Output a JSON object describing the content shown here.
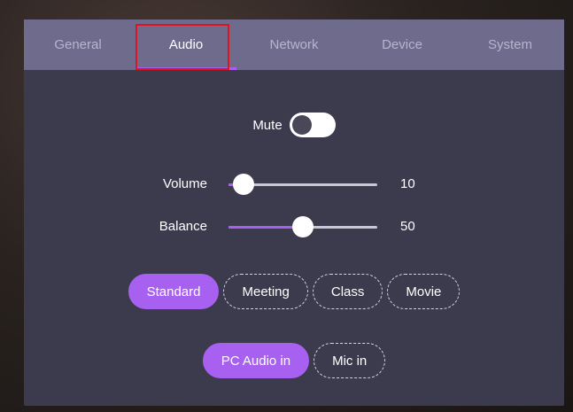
{
  "tabs": [
    {
      "label": "General"
    },
    {
      "label": "Audio"
    },
    {
      "label": "Network"
    },
    {
      "label": "Device"
    },
    {
      "label": "System"
    }
  ],
  "active_tab": "Audio",
  "mute": {
    "label": "Mute",
    "on": false
  },
  "volume": {
    "label": "Volume",
    "value": "10",
    "fraction": 0.1
  },
  "balance": {
    "label": "Balance",
    "value": "50",
    "fraction": 0.5
  },
  "sound_modes": [
    {
      "label": "Standard",
      "active": true
    },
    {
      "label": "Meeting",
      "active": false
    },
    {
      "label": "Class",
      "active": false
    },
    {
      "label": "Movie",
      "active": false
    }
  ],
  "audio_inputs": [
    {
      "label": "PC Audio in",
      "active": true
    },
    {
      "label": "Mic in",
      "active": false
    }
  ],
  "colors": {
    "accent": "#a860f0",
    "panel": "#3c3a4d",
    "tabbar": "#6e6b8c",
    "highlight": "#e0141f"
  }
}
